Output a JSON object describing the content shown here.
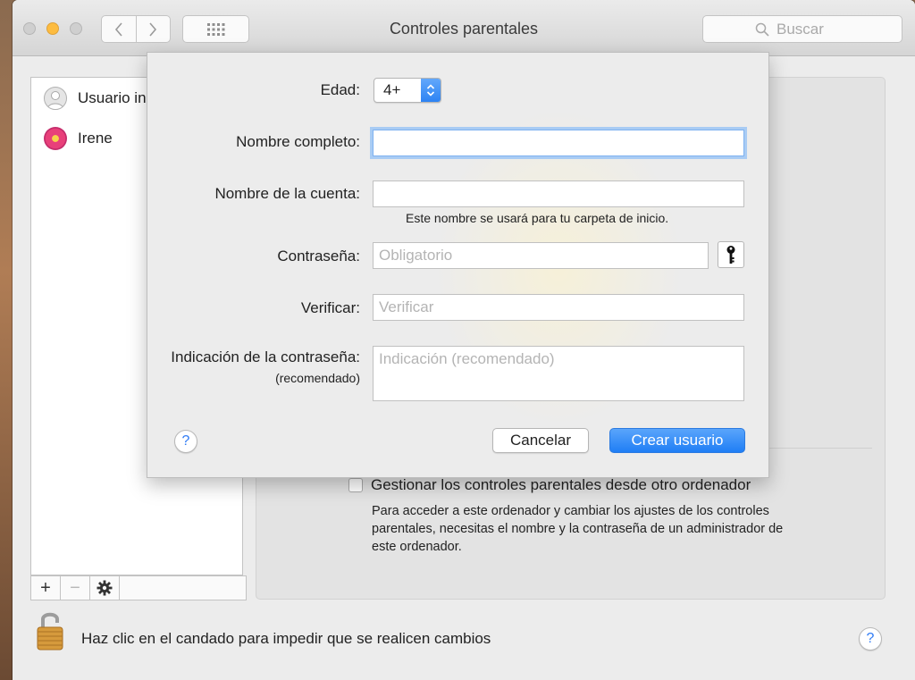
{
  "window": {
    "title": "Controles parentales",
    "search_placeholder": "Buscar"
  },
  "sidebar": {
    "users": [
      {
        "name": "Usuario in",
        "avatar": "generic-user-icon"
      },
      {
        "name": "Irene",
        "avatar": "flower-avatar"
      }
    ],
    "toolbar": {
      "add": "+",
      "remove": "−",
      "gear": "gear-icon"
    }
  },
  "main": {
    "manage_label": "Gestionar los controles parentales desde otro ordenador",
    "manage_checked": false,
    "manage_desc": "Para acceder a este ordenador y cambiar los ajustes de los controles parentales, necesitas el nombre y la contraseña de un administrador de este ordenador."
  },
  "footer": {
    "lock_text": "Haz clic en el candado para impedir que se realicen cambios",
    "help": "?"
  },
  "sheet": {
    "age_label": "Edad:",
    "age_value": "4+",
    "fullname_label": "Nombre completo:",
    "fullname_value": "",
    "account_label": "Nombre de la cuenta:",
    "account_value": "",
    "account_hint": "Este nombre se usará para tu carpeta de inicio.",
    "password_label": "Contraseña:",
    "password_placeholder": "Obligatorio",
    "verify_label": "Verificar:",
    "verify_placeholder": "Verificar",
    "hint_label": "Indicación de la contraseña:",
    "hint_sublabel": "(recomendado)",
    "hint_placeholder": "Indicación (recomendado)",
    "help": "?",
    "cancel_label": "Cancelar",
    "create_label": "Crear usuario"
  },
  "colors": {
    "accent": "#2f7bf5",
    "minimize": "#fdbc40"
  }
}
